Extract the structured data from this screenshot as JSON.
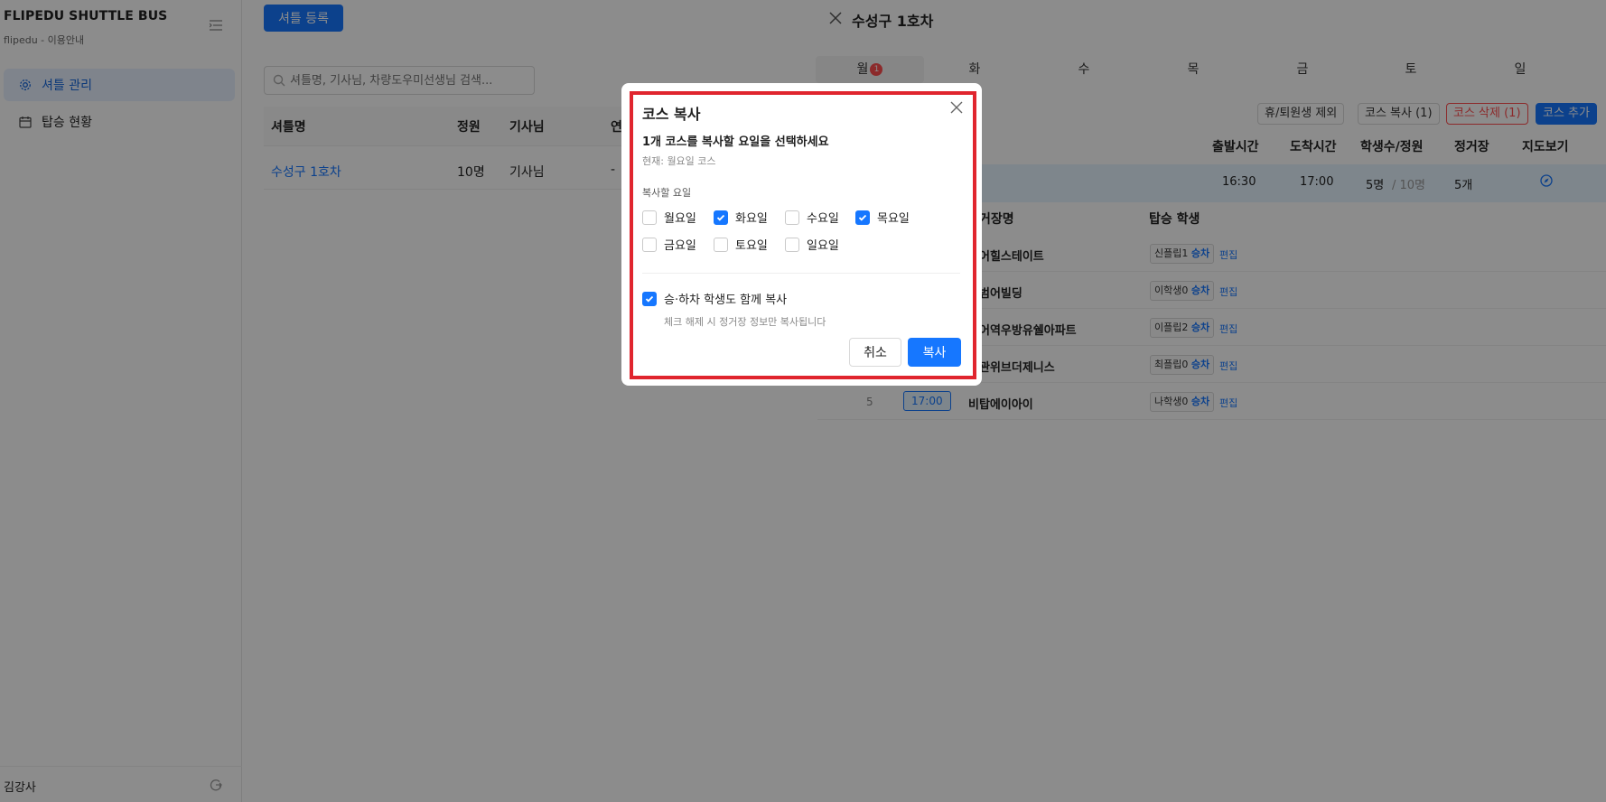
{
  "sidebar": {
    "brand": "FLIPEDU SHUTTLE BUS",
    "brand_sub": "flipedu - 이용안내",
    "items": [
      {
        "label": "셔틀 관리"
      },
      {
        "label": "탑승 현황"
      }
    ],
    "user": "김강사"
  },
  "main": {
    "register_button": "셔틀 등록",
    "search_placeholder": "셔틀명, 기사님, 차량도우미선생님 검색...",
    "columns": [
      "셔틀명",
      "정원",
      "기사님",
      "연"
    ],
    "rows": [
      {
        "name": "수성구 1호차",
        "capacity": "10명",
        "driver": "기사님",
        "extra": "-"
      }
    ]
  },
  "drawer": {
    "title": "수성구 1호차",
    "days": [
      "월",
      "화",
      "수",
      "목",
      "금",
      "토",
      "일"
    ],
    "active_day_badge": "1",
    "buttons": {
      "exclude": "휴/퇴원생 제외",
      "copy": "코스 복사 (1)",
      "delete": "코스 삭제 (1)",
      "add": "코스 추가"
    },
    "course_columns": [
      "출발시간",
      "도착시간",
      "학생수/정원",
      "정거장",
      "지도보기"
    ],
    "course": {
      "depart": "16:30",
      "arrive": "17:00",
      "students": "5명",
      "capacity": "/ 10명",
      "stops": "5개"
    },
    "stop_columns": [
      "거장명",
      "탑승 학생"
    ],
    "stops": [
      {
        "name": "어힐스테이트",
        "student": "신플립1",
        "action": "승차",
        "edit": "편집"
      },
      {
        "name": "범어빌딩",
        "student": "이학생0",
        "action": "승차",
        "edit": "편집"
      },
      {
        "name": "어역우방유쉘아파트",
        "student": "이플립2",
        "action": "승차",
        "edit": "편집"
      },
      {
        "name": "관위브더제니스",
        "student": "최플립0",
        "action": "승차",
        "edit": "편집"
      },
      {
        "name": "비탑에이아이",
        "student": "나학생0",
        "action": "승차",
        "edit": "편집",
        "index": "5",
        "time": "17:00"
      }
    ]
  },
  "modal": {
    "title": "코스 복사",
    "question": "1개 코스를 복사할 요일을 선택하세요",
    "current": "현재: 월요일 코스",
    "days_label": "복사할 요일",
    "days": [
      {
        "label": "월요일",
        "checked": false
      },
      {
        "label": "화요일",
        "checked": true
      },
      {
        "label": "수요일",
        "checked": false
      },
      {
        "label": "목요일",
        "checked": true
      },
      {
        "label": "금요일",
        "checked": false
      },
      {
        "label": "토요일",
        "checked": false
      },
      {
        "label": "일요일",
        "checked": false
      }
    ],
    "copy_students_label": "승·하차 학생도 함께 복사",
    "copy_students_checked": true,
    "hint": "체크 해제 시 정거장 정보만 복사됩니다",
    "cancel": "취소",
    "confirm": "복사"
  },
  "colors": {
    "primary": "#1677ff",
    "danger": "#ff4d4f",
    "highlight": "#e0252e"
  }
}
